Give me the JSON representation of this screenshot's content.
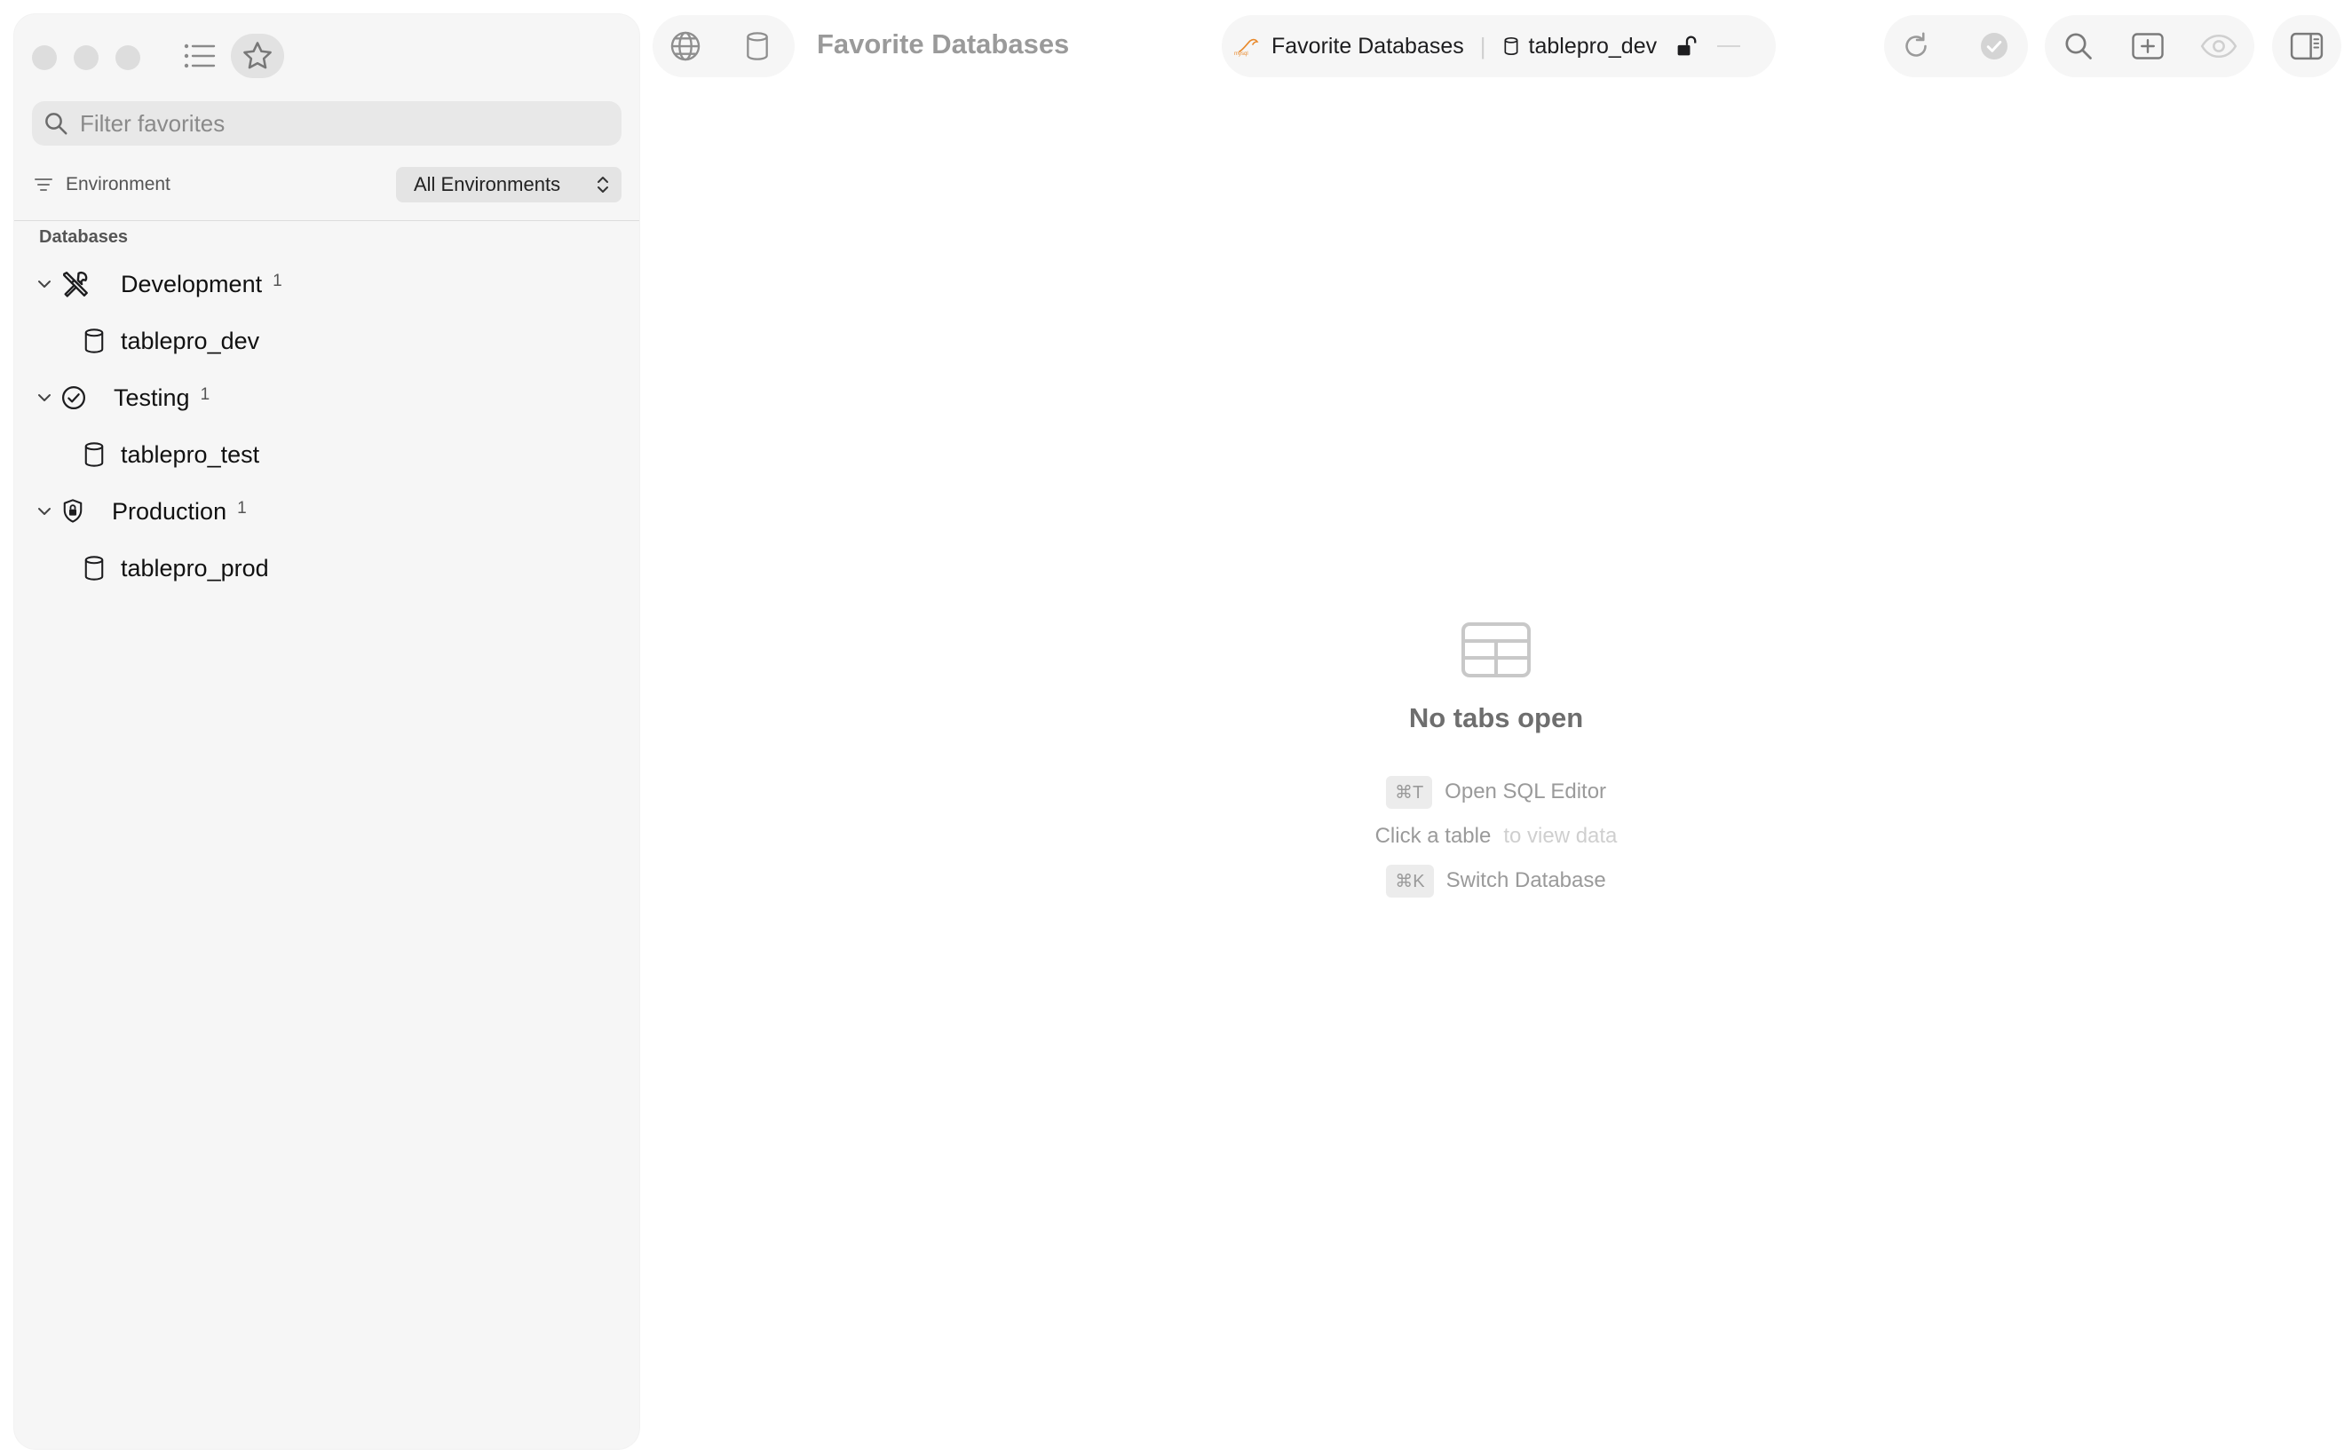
{
  "sidebar": {
    "search": {
      "placeholder": "Filter favorites",
      "value": ""
    },
    "environment": {
      "label": "Environment",
      "selected": "All Environments"
    },
    "section_title": "Databases",
    "groups": [
      {
        "name": "Development",
        "count": "1",
        "icon": "tools-icon",
        "databases": [
          "tablepro_dev"
        ]
      },
      {
        "name": "Testing",
        "count": "1",
        "icon": "check-circle-icon",
        "databases": [
          "tablepro_test"
        ]
      },
      {
        "name": "Production",
        "count": "1",
        "icon": "shield-lock-icon",
        "databases": [
          "tablepro_prod"
        ]
      }
    ]
  },
  "toolbar": {
    "title": "Favorite Databases",
    "breadcrumb": {
      "engine_label": "mysql",
      "connection": "Favorite Databases",
      "database": "tablepro_dev",
      "separator": "|"
    }
  },
  "empty_state": {
    "title": "No tabs open",
    "hints": [
      {
        "key": "⌘T",
        "text": "Open SQL Editor"
      },
      {
        "key": "",
        "text": "Click a table",
        "dim": "to view data"
      },
      {
        "key": "⌘K",
        "text": "Switch Database"
      }
    ]
  },
  "colors": {
    "sidebar_bg": "#f6f6f6",
    "accent_engine": "#e8892b",
    "muted_text": "#9a9a9a"
  }
}
